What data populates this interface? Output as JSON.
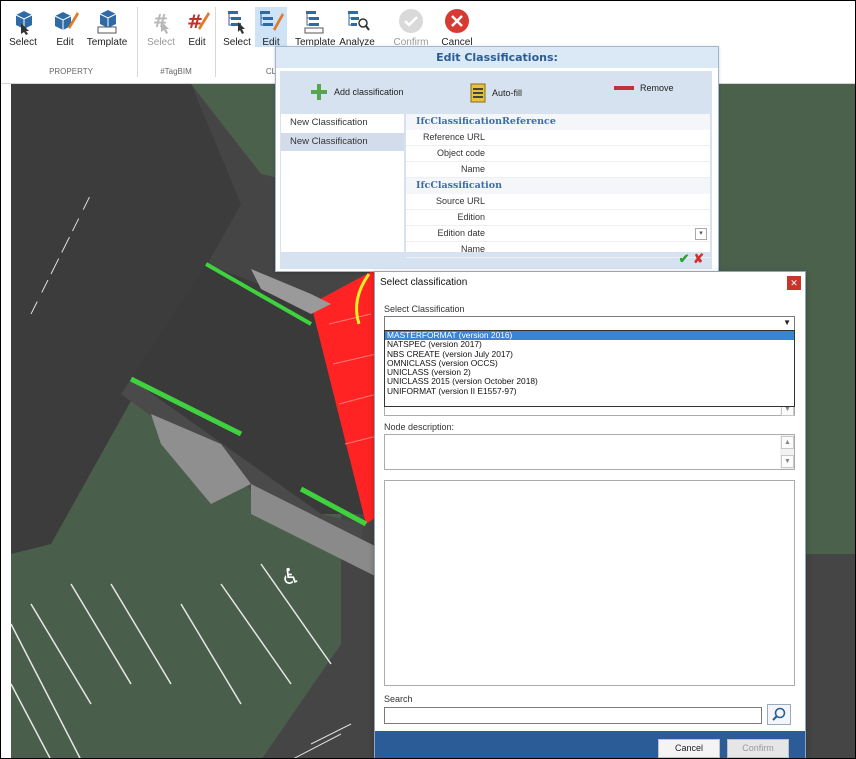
{
  "ribbon": {
    "buttons": [
      {
        "label": "Select",
        "icon": "cube-select-icon",
        "dim": false
      },
      {
        "label": "Edit",
        "icon": "cube-edit-icon",
        "dim": false
      },
      {
        "label": "Template",
        "icon": "cube-template-icon",
        "dim": false
      },
      {
        "label": "Select",
        "icon": "hashtag-select-icon",
        "dim": true
      },
      {
        "label": "Edit",
        "icon": "hashtag-edit-icon",
        "dim": false
      },
      {
        "label": "Select",
        "icon": "classification-select-icon",
        "dim": false
      },
      {
        "label": "Edit",
        "icon": "classification-edit-icon",
        "dim": false
      },
      {
        "label": "Template",
        "icon": "classification-template-icon",
        "dim": false
      },
      {
        "label": "Analyze",
        "icon": "classification-analyze-icon",
        "dim": false
      },
      {
        "label": "Confirm",
        "icon": "check-icon",
        "dim": true
      },
      {
        "label": "Cancel",
        "icon": "cancel-icon",
        "dim": false
      }
    ],
    "groups": [
      "PROPERTY",
      "#TagBIM",
      "CL"
    ]
  },
  "edit_dialog": {
    "title": "Edit Classifications:",
    "toolbar": {
      "add": "Add classification",
      "autofill": "Auto-fill",
      "remove": "Remove"
    },
    "list": [
      "New Classification",
      "New Classification"
    ],
    "sections": [
      {
        "header": "IfcClassificationReference",
        "rows": [
          "Reference URL",
          "Object code",
          "Name"
        ]
      },
      {
        "header": "IfcClassification",
        "rows": [
          "Source URL",
          "Edition",
          "Edition date",
          "Name"
        ]
      }
    ]
  },
  "select_dialog": {
    "title": "Select classification",
    "combo_label": "Select Classification",
    "combo_value": "",
    "options": [
      "MASTERFORMAT  (version 2016)",
      "NATSPEC  (version 2017)",
      "NBS CREATE  (version July 2017)",
      "OMNICLASS  (version OCCS)",
      "UNICLASS  (version 2)",
      "UNICLASS  2015 (version October 2018)",
      "UNIFORMAT  (version II E1557-97)"
    ],
    "selected_option": 0,
    "node_description_label": "Node description:",
    "search_label": "Search",
    "search_value": "",
    "cancel": "Cancel",
    "confirm": "Confirm"
  },
  "colors": {
    "accent": "#2c5c98",
    "title_blue": "#2a5d95",
    "highlight": "#3a84d6",
    "map_dark": "#3b3b3b",
    "map_green": "#48614a",
    "selection_red": "#ff2020",
    "edge_green": "#3ed23e"
  }
}
